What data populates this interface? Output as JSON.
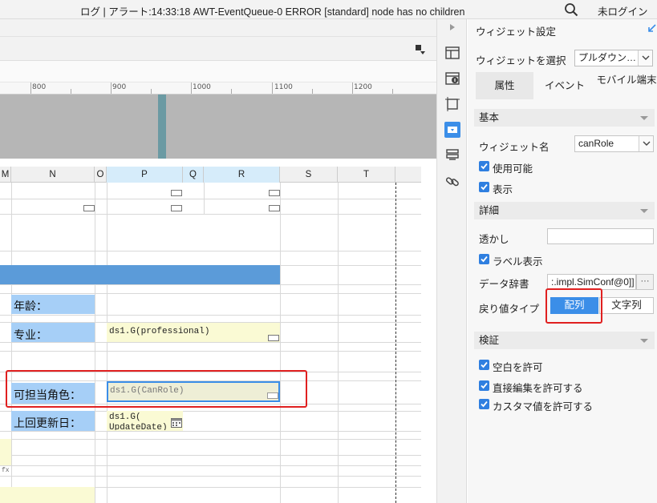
{
  "topbar": {
    "status": "ログ | アラート:14:33:18 AWT-EventQueue-0 ERROR [standard] node has no children",
    "login": "未ログイン"
  },
  "ruler": {
    "labels": [
      "800",
      "900",
      "1000",
      "1100",
      "1200"
    ]
  },
  "sheet": {
    "columns": [
      "M",
      "N",
      "O",
      "P",
      "Q",
      "R",
      "S",
      "T"
    ],
    "labels": {
      "age": "年龄：",
      "major": "专业：",
      "role": "可担当角色：",
      "updated": "上回更新日："
    },
    "formulas": {
      "professional": "ds1.G(professional)",
      "canrole": "ds1.G(CanRole)",
      "updated_line1": "ds1.G(",
      "updated_line2": "UpdateDate)"
    },
    "small_fx": "fx"
  },
  "panel": {
    "title": "ウィジェット設定",
    "widget_select_label": "ウィジェットを選択",
    "widget_select_value": "プルダウン…",
    "tabs": [
      "属性",
      "イベント",
      "モバイル端末"
    ],
    "sections": {
      "basic": "基本",
      "detail": "詳細",
      "validation": "検証"
    },
    "widget_name_label": "ウィジェット名",
    "widget_name_value": "canRole",
    "enabled": "使用可能",
    "visible": "表示",
    "transparency": "透かし",
    "show_label": "ラベル表示",
    "dictionary_label": "データ辞書",
    "dictionary_value": ":.impl.SimConf@0]]",
    "ellipsis": "···",
    "return_type_label": "戻り値タイプ",
    "return_type_array": "配列",
    "return_type_string": "文字列",
    "allow_empty": "空白を許可",
    "allow_direct_edit": "直接編集を許可する",
    "allow_custom": "カスタマ値を許可する"
  },
  "colors": {
    "accent": "#3b8ee8",
    "highlight": "#e02020",
    "label_cell": "#a6cff7",
    "formula_cell": "#fafad4"
  }
}
